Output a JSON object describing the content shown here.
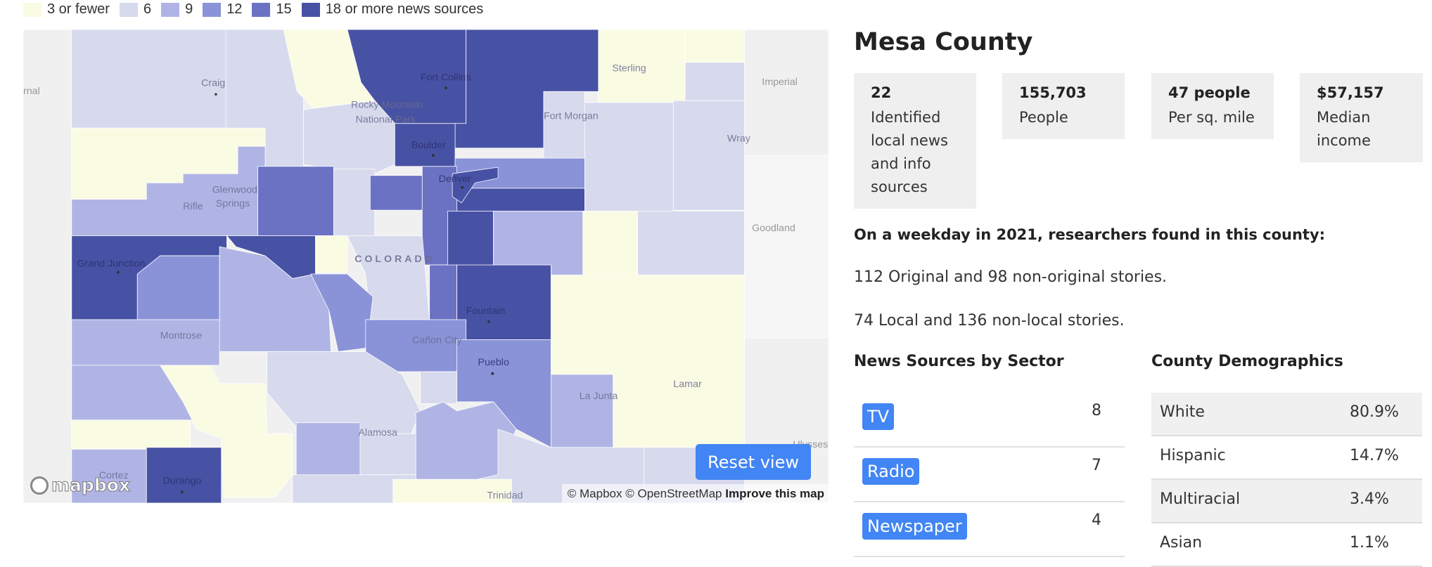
{
  "legend": {
    "colors": [
      "#fafbe3",
      "#d7d9ed",
      "#b0b4e5",
      "#8a92d8",
      "#6b72c4",
      "#4852a4"
    ],
    "items": [
      "3 or fewer",
      "6",
      "9",
      "12",
      "15",
      "18 or more news sources"
    ]
  },
  "map": {
    "labels": [
      "Craig",
      "Fort Collins",
      "Sterling",
      "Imperial",
      "Rocky Mountain",
      "National Park",
      "Fort Morgan",
      "Boulder",
      "Wray",
      "Denver",
      "Glenwood",
      "Springs",
      "Rifle",
      "Goodland",
      "Grand Junction",
      "COLORADO",
      "Fountain",
      "Montrose",
      "Cañon City",
      "Pueblo",
      "Lamar",
      "La Junta",
      "Alamosa",
      "Cortez",
      "Durango",
      "Trinidad",
      "Ulysses",
      "rnal"
    ],
    "reset_label": "Reset view",
    "attribution": {
      "mapbox": "© Mapbox",
      "osm": "© OpenStreetMap",
      "improve": "Improve this map"
    },
    "logo": "mapbox"
  },
  "county": {
    "name": "Mesa County",
    "stats": [
      {
        "value": "22",
        "label": "Identified local news and info sources"
      },
      {
        "value": "155,703",
        "label": "People"
      },
      {
        "value": "47 people",
        "label": "Per sq. mile"
      },
      {
        "value": "$57,157",
        "label": "Median income"
      }
    ],
    "found_heading": "On a weekday in 2021, researchers found in this county:",
    "original_line": "112 Original and 98 non-original stories.",
    "local_line": "74 Local and 136 non-local stories.",
    "sector_heading": "News Sources by Sector",
    "sectors": [
      {
        "label": "TV",
        "count": "8"
      },
      {
        "label": "Radio",
        "count": "7"
      },
      {
        "label": "Newspaper",
        "count": "4"
      }
    ],
    "demo_heading": "County Demographics",
    "demographics": [
      {
        "label": "White",
        "pct": "80.9%"
      },
      {
        "label": "Hispanic",
        "pct": "14.7%"
      },
      {
        "label": "Multiracial",
        "pct": "3.4%"
      },
      {
        "label": "Asian",
        "pct": "1.1%"
      }
    ]
  },
  "accent": "#4285f4"
}
